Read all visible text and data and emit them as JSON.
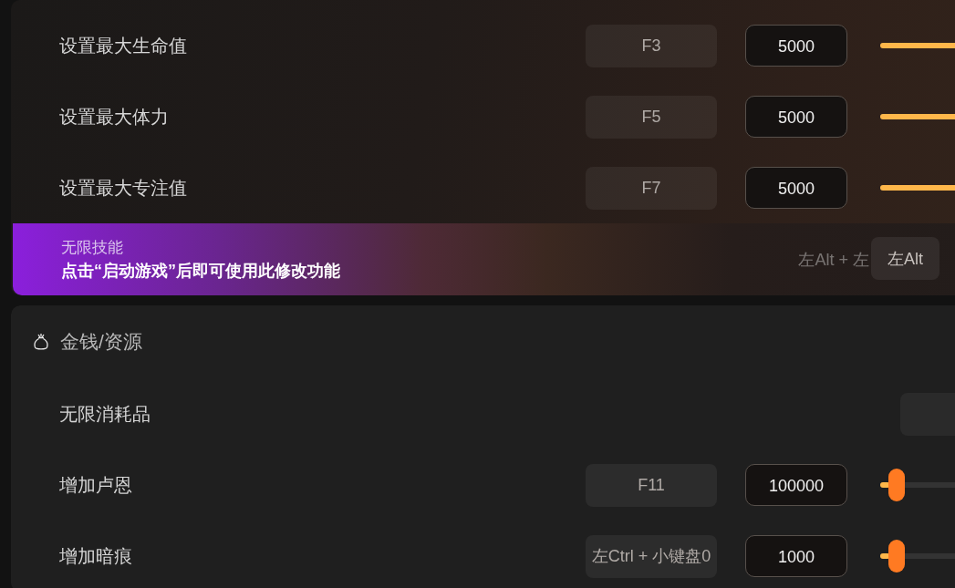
{
  "panels": [
    {
      "rows": [
        {
          "kind": "slider",
          "label": "设置最大生命值",
          "hotkey": "F3",
          "value": "5000",
          "level": 0.6
        },
        {
          "kind": "slider",
          "label": "设置最大体力",
          "hotkey": "F5",
          "value": "5000",
          "level": 0.6
        },
        {
          "kind": "slider",
          "label": "设置最大专注值",
          "hotkey": "F7",
          "value": "5000",
          "level": 0.6
        },
        {
          "kind": "locked",
          "label": "无限技能",
          "notice": "点击“启动游戏”后即可使用此修改功能",
          "hotkey_hint": "左Alt + 左",
          "hotkey": "左Alt"
        }
      ]
    },
    {
      "title": "金钱/资源",
      "rows": [
        {
          "kind": "toggle",
          "label": "无限消耗品"
        },
        {
          "kind": "slider",
          "label": "增加卢恩",
          "hotkey": "F11",
          "value": "100000",
          "level": 0.07
        },
        {
          "kind": "slider",
          "label": "增加暗痕",
          "hotkey": "左Ctrl + 小键盘0",
          "value": "1000",
          "level": 0.07
        }
      ]
    }
  ]
}
